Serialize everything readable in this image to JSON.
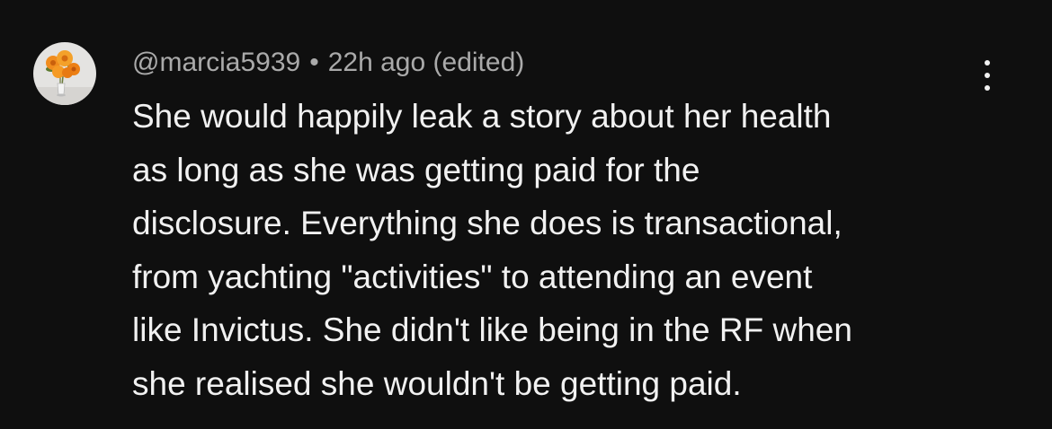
{
  "comment": {
    "author": "@marcia5939",
    "separator": "•",
    "timestamp": "22h ago",
    "edited_label": "(edited)",
    "body_lines": [
      "She would happily leak a story about her health",
      "as long as she was getting paid for the",
      "disclosure. Everything she does is transactional,",
      "from yachting \"activities\" to attending an event",
      "like Invictus. She didn't like being in the RF when",
      "she realised she wouldn't be getting paid."
    ],
    "avatar_icon": "orange-roses-in-vase-avatar",
    "menu_icon": "more-vertical-icon"
  },
  "colors": {
    "background": "#0f0f0f",
    "header_text": "#aaaaaa",
    "body_text": "#f1f1f1"
  }
}
